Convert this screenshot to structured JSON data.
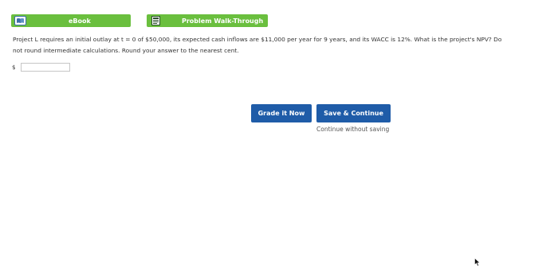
{
  "top_buttons": {
    "ebook_label": "eBook",
    "walkthrough_label": "Problem Walk-Through",
    "ebook_icon": "book-icon",
    "walkthrough_icon": "document-icon"
  },
  "question": {
    "text": "Project L requires an initial outlay at t = 0 of $50,000, its expected cash inflows are $11,000 per year for 9 years, and its WACC is 12%. What is the project's NPV? Do\nnot round intermediate calculations. Round your answer to the nearest cent."
  },
  "answer": {
    "currency_symbol": "$",
    "value": ""
  },
  "actions": {
    "grade_label": "Grade it Now",
    "save_label": "Save & Continue",
    "continue_label": "Continue without saving"
  },
  "colors": {
    "green": "#6abf3e",
    "blue": "#1f5ca8"
  }
}
